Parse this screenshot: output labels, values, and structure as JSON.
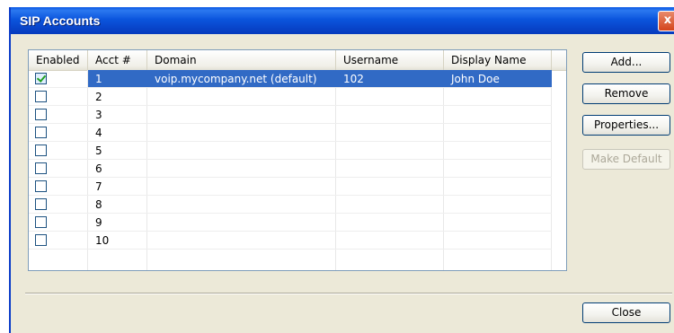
{
  "window": {
    "title": "SIP Accounts",
    "close_glyph": "x"
  },
  "columns": [
    "Enabled",
    "Acct #",
    "Domain",
    "Username",
    "Display Name"
  ],
  "rows": [
    {
      "enabled": true,
      "acct": "1",
      "domain": "voip.mycompany.net (default)",
      "username": "102",
      "display_name": "John Doe",
      "selected": true
    },
    {
      "enabled": false,
      "acct": "2",
      "domain": "",
      "username": "",
      "display_name": ""
    },
    {
      "enabled": false,
      "acct": "3",
      "domain": "",
      "username": "",
      "display_name": ""
    },
    {
      "enabled": false,
      "acct": "4",
      "domain": "",
      "username": "",
      "display_name": ""
    },
    {
      "enabled": false,
      "acct": "5",
      "domain": "",
      "username": "",
      "display_name": ""
    },
    {
      "enabled": false,
      "acct": "6",
      "domain": "",
      "username": "",
      "display_name": ""
    },
    {
      "enabled": false,
      "acct": "7",
      "domain": "",
      "username": "",
      "display_name": ""
    },
    {
      "enabled": false,
      "acct": "8",
      "domain": "",
      "username": "",
      "display_name": ""
    },
    {
      "enabled": false,
      "acct": "9",
      "domain": "",
      "username": "",
      "display_name": ""
    },
    {
      "enabled": false,
      "acct": "10",
      "domain": "",
      "username": "",
      "display_name": ""
    }
  ],
  "buttons": {
    "add": "Add...",
    "remove": "Remove",
    "properties": "Properties...",
    "make_default": "Make Default",
    "close": "Close"
  },
  "colors": {
    "titlebar": "#0a58e4",
    "selection": "#316ac5",
    "dialog_bg": "#ece9d8"
  }
}
